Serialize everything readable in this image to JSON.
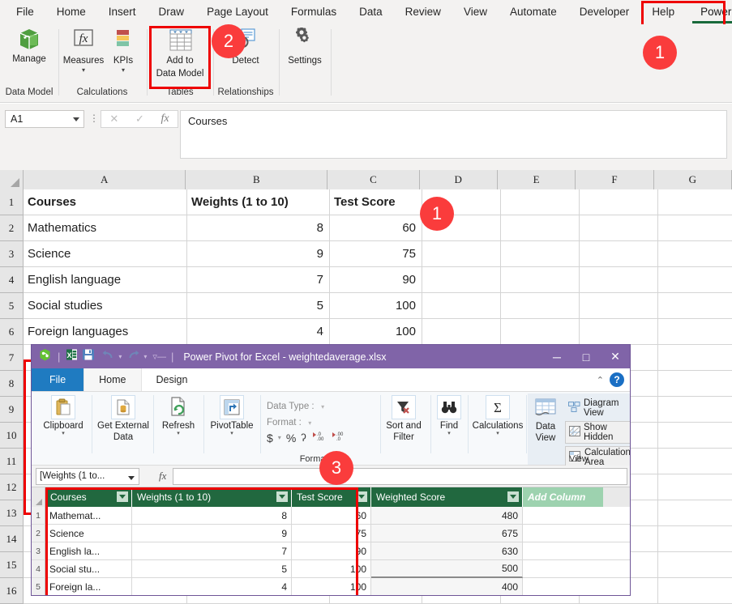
{
  "excel": {
    "tabs": [
      {
        "label": "File"
      },
      {
        "label": "Home"
      },
      {
        "label": "Insert"
      },
      {
        "label": "Draw"
      },
      {
        "label": "Page Layout"
      },
      {
        "label": "Formulas"
      },
      {
        "label": "Data"
      },
      {
        "label": "Review"
      },
      {
        "label": "View"
      },
      {
        "label": "Automate"
      },
      {
        "label": "Developer"
      },
      {
        "label": "Help"
      },
      {
        "label": "Power Pivot"
      }
    ],
    "ribbon": {
      "groups": [
        {
          "name": "Data Model",
          "label": "Data Model",
          "buttons": [
            {
              "label_1": "Manage",
              "label_2": "",
              "icon": "manage-cube-icon"
            }
          ]
        },
        {
          "name": "Calculations",
          "label": "Calculations",
          "buttons": [
            {
              "label_1": "Measures",
              "label_2": "",
              "icon": "fx-measures-icon"
            },
            {
              "label_1": "KPIs",
              "label_2": "",
              "icon": "kpi-bars-icon"
            }
          ]
        },
        {
          "name": "Tables",
          "label": "Tables",
          "buttons": [
            {
              "label_1": "Add to",
              "label_2": "Data Model",
              "icon": "table-grid-icon"
            }
          ]
        },
        {
          "name": "Relationships",
          "label": "Relationships",
          "buttons": [
            {
              "label_1": "Detect",
              "label_2": "",
              "icon": "detect-magnifier-icon"
            }
          ]
        },
        {
          "name": "Settings",
          "label": "",
          "buttons": [
            {
              "label_1": "Settings",
              "label_2": "",
              "icon": "gear-icon"
            }
          ]
        }
      ]
    },
    "namebox": {
      "value": "A1"
    },
    "formula_bar": {
      "value": "Courses"
    },
    "columns": [
      "A",
      "B",
      "C",
      "D",
      "E",
      "F",
      "G"
    ],
    "rows": [
      "1",
      "2",
      "3",
      "4",
      "5",
      "6",
      "7",
      "8",
      "9",
      "10",
      "11",
      "12",
      "13",
      "14",
      "15",
      "16"
    ],
    "sheet_data": [
      [
        "Courses",
        "Weights (1 to 10)",
        "Test Score"
      ],
      [
        "Mathematics",
        "8",
        "60"
      ],
      [
        "Science",
        "9",
        "75"
      ],
      [
        "English language",
        "7",
        "90"
      ],
      [
        "Social studies",
        "5",
        "100"
      ],
      [
        "Foreign languages",
        "4",
        "100"
      ]
    ]
  },
  "powerpivot": {
    "window_title": "Power Pivot for Excel - weightedaverage.xlsx",
    "window_buttons": {
      "minimize": "─",
      "maximize": "□",
      "close": "✕"
    },
    "help_label": "?",
    "collapse_label": "⌃",
    "tabs": [
      {
        "label": "File"
      },
      {
        "label": "Home"
      },
      {
        "label": "Design"
      }
    ],
    "ribbon": {
      "clipboard": {
        "label_1": "Clipboard",
        "label_2": "",
        "group": ""
      },
      "get_external": {
        "label_1": "Get External",
        "label_2": "Data"
      },
      "refresh": {
        "label_1": "Refresh",
        "label_2": ""
      },
      "pivottable": {
        "label_1": "PivotTable",
        "label_2": ""
      },
      "formatting": {
        "group": "Formatting",
        "data_type_label": "Data Type :",
        "format_label": "Format :",
        "currency": "$",
        "percent": "%",
        "comma": "ʔ",
        "inc_dec": ".00",
        "dec_dec": ".00"
      },
      "sort_filter": {
        "label_1": "Sort and",
        "label_2": "Filter"
      },
      "find": {
        "label_1": "Find",
        "label_2": ""
      },
      "calculations": {
        "label_1": "Calculations",
        "label_2": ""
      },
      "view": {
        "group": "View",
        "data_view_1": "Data",
        "data_view_2": "View",
        "diagram_view": "Diagram View",
        "show_hidden": "Show Hidden",
        "calculation_area": "Calculation Area"
      }
    },
    "formula_bar": {
      "column_selector": "[Weights (1 to...",
      "value": ""
    },
    "table": {
      "headers": [
        "Courses",
        "Weights (1 to 10)",
        "Test Score",
        "Weighted Score",
        "Add Column"
      ],
      "rows": [
        {
          "num": "1",
          "cells": [
            "Mathemat...",
            "8",
            "60",
            "480"
          ]
        },
        {
          "num": "2",
          "cells": [
            "Science",
            "9",
            "75",
            "675"
          ]
        },
        {
          "num": "3",
          "cells": [
            "English la...",
            "7",
            "90",
            "630"
          ]
        },
        {
          "num": "4",
          "cells": [
            "Social stu...",
            "5",
            "100",
            "500"
          ]
        },
        {
          "num": "5",
          "cells": [
            "Foreign la...",
            "4",
            "100",
            "400"
          ]
        }
      ]
    }
  },
  "annotations": {
    "badges": [
      {
        "id": "badge-1-ribbon",
        "label": "1"
      },
      {
        "id": "badge-2-addtodatamodel",
        "label": "2"
      },
      {
        "id": "badge-1-sheetdata",
        "label": "1"
      },
      {
        "id": "badge-3-powerpivot",
        "label": "3"
      }
    ],
    "highlight_color": "#ee0000",
    "badge_color": "#fa3c3c"
  }
}
